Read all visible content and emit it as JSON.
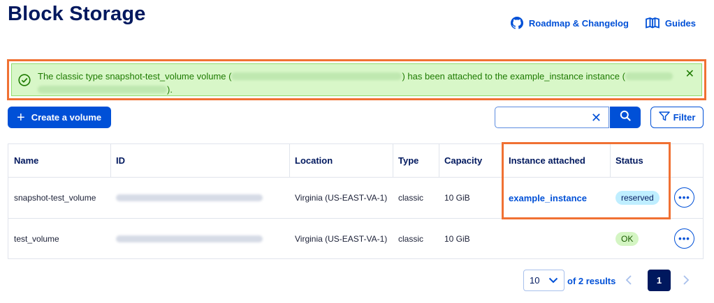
{
  "page": {
    "title": "Block Storage"
  },
  "top_links": {
    "roadmap": {
      "label": "Roadmap & Changelog",
      "icon": "github-icon"
    },
    "guides": {
      "label": "Guides",
      "icon": "book-icon"
    }
  },
  "banner": {
    "part1": "The classic type snapshot-test_volume volume (",
    "part2": ") has been attached to the example_instance instance (",
    "part3": ").",
    "icon": "check-circle-icon",
    "close_icon": "close-icon",
    "color": "#1d7a00",
    "background": "#d8f7c8"
  },
  "toolbar": {
    "create_label": "Create a volume",
    "search_value": "",
    "filter_label": "Filter"
  },
  "table": {
    "columns": [
      "Name",
      "ID",
      "Location",
      "Type",
      "Capacity",
      "Instance attached",
      "Status"
    ],
    "rows": [
      {
        "name": "snapshot-test_volume",
        "location": "Virginia (US-EAST-VA-1)",
        "type": "classic",
        "capacity": "10 GiB",
        "instance": "example_instance",
        "status": "reserved"
      },
      {
        "name": "test_volume",
        "location": "Virginia (US-EAST-VA-1)",
        "type": "classic",
        "capacity": "10 GiB",
        "instance": "",
        "status": "OK"
      }
    ]
  },
  "pagination": {
    "per_page": "10",
    "results_text": "of 2 results",
    "current_page": "1"
  },
  "colors": {
    "primary": "#0050d7",
    "title": "#00185e",
    "highlight": "#f07133"
  }
}
